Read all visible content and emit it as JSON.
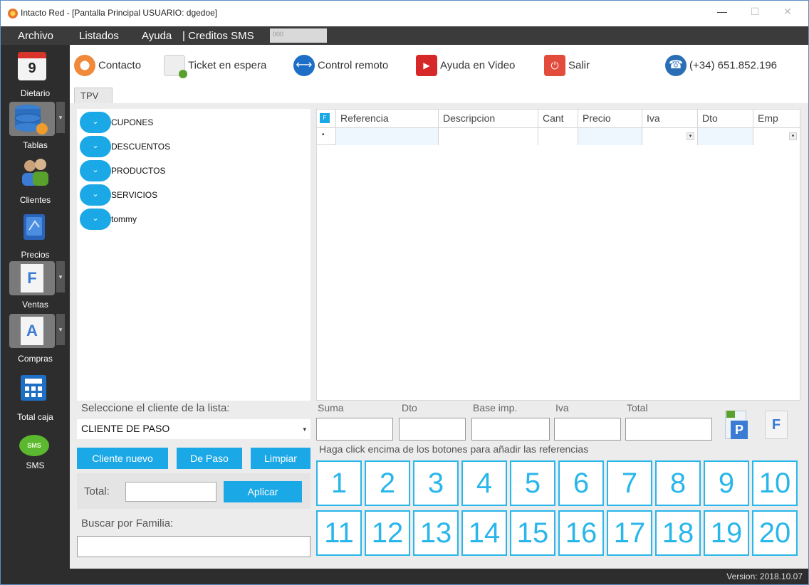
{
  "window": {
    "title": "Intacto Red - [Pantalla Principal USUARIO: dgedoe]",
    "minimize": "—",
    "maximize": "☐",
    "close": "✕"
  },
  "menu": {
    "items": [
      "Archivo",
      "Listados",
      "Ayuda",
      "| Creditos SMS"
    ],
    "sms_value": "000"
  },
  "sidebar": {
    "calendar_day": "9",
    "items": [
      {
        "label": "Dietario",
        "icon": "calendar-icon"
      },
      {
        "label": "Tablas",
        "icon": "database-icon"
      },
      {
        "label": "Clientes",
        "icon": "users-icon"
      },
      {
        "label": "Precios",
        "icon": "price-book-icon"
      },
      {
        "label": "Ventas",
        "icon": "invoice-f-icon"
      },
      {
        "label": "Compras",
        "icon": "invoice-a-icon"
      },
      {
        "label": "Total caja",
        "icon": "calculator-icon"
      },
      {
        "label": "SMS",
        "icon": "sms-bubble-icon"
      }
    ],
    "sms_bubble_text": "SMS",
    "doc_f": "F",
    "doc_a": "A"
  },
  "toolbar": {
    "contacto": "Contacto",
    "ticket": "Ticket en espera",
    "control": "Control remoto",
    "video": "Ayuda en Video",
    "salir": "Salir",
    "phone": "(+34) 651.852.196"
  },
  "tab": {
    "label": "TPV"
  },
  "categories": [
    "CUPONES",
    "DESCUENTOS",
    "PRODUCTOS",
    "SERVICIOS",
    "tommy"
  ],
  "grid": {
    "corner": "F",
    "columns": [
      "Referencia",
      "Descripcion",
      "Cant",
      "Precio",
      "Iva",
      "Dto",
      "Emp"
    ],
    "row_marker": "•"
  },
  "client": {
    "select_label": "Seleccione el cliente de la lista:",
    "selected": "CLIENTE DE PASO",
    "btn_nuevo": "Cliente nuevo",
    "btn_paso": "De Paso",
    "btn_limpiar": "Limpiar",
    "total_label": "Total:",
    "total_value": "",
    "btn_aplicar": "Aplicar",
    "familia_label": "Buscar por Familia:",
    "familia_value": ""
  },
  "totals": {
    "labels": [
      "Suma",
      "Dto",
      "Base imp.",
      "Iva",
      "Total"
    ],
    "values": [
      "",
      "",
      "",
      "",
      ""
    ]
  },
  "doc_buttons": {
    "p": "P",
    "f": "F"
  },
  "hint": "Haga click encima de los botones para añadir las referencias",
  "numbers": [
    "1",
    "2",
    "3",
    "4",
    "5",
    "6",
    "7",
    "8",
    "9",
    "10",
    "11",
    "12",
    "13",
    "14",
    "15",
    "16",
    "17",
    "18",
    "19",
    "20"
  ],
  "status": {
    "version": "Version: 2018.10.07"
  },
  "colors": {
    "accent": "#1ba8e6",
    "number": "#29b6ea",
    "sidebar": "#2d2d2d"
  }
}
